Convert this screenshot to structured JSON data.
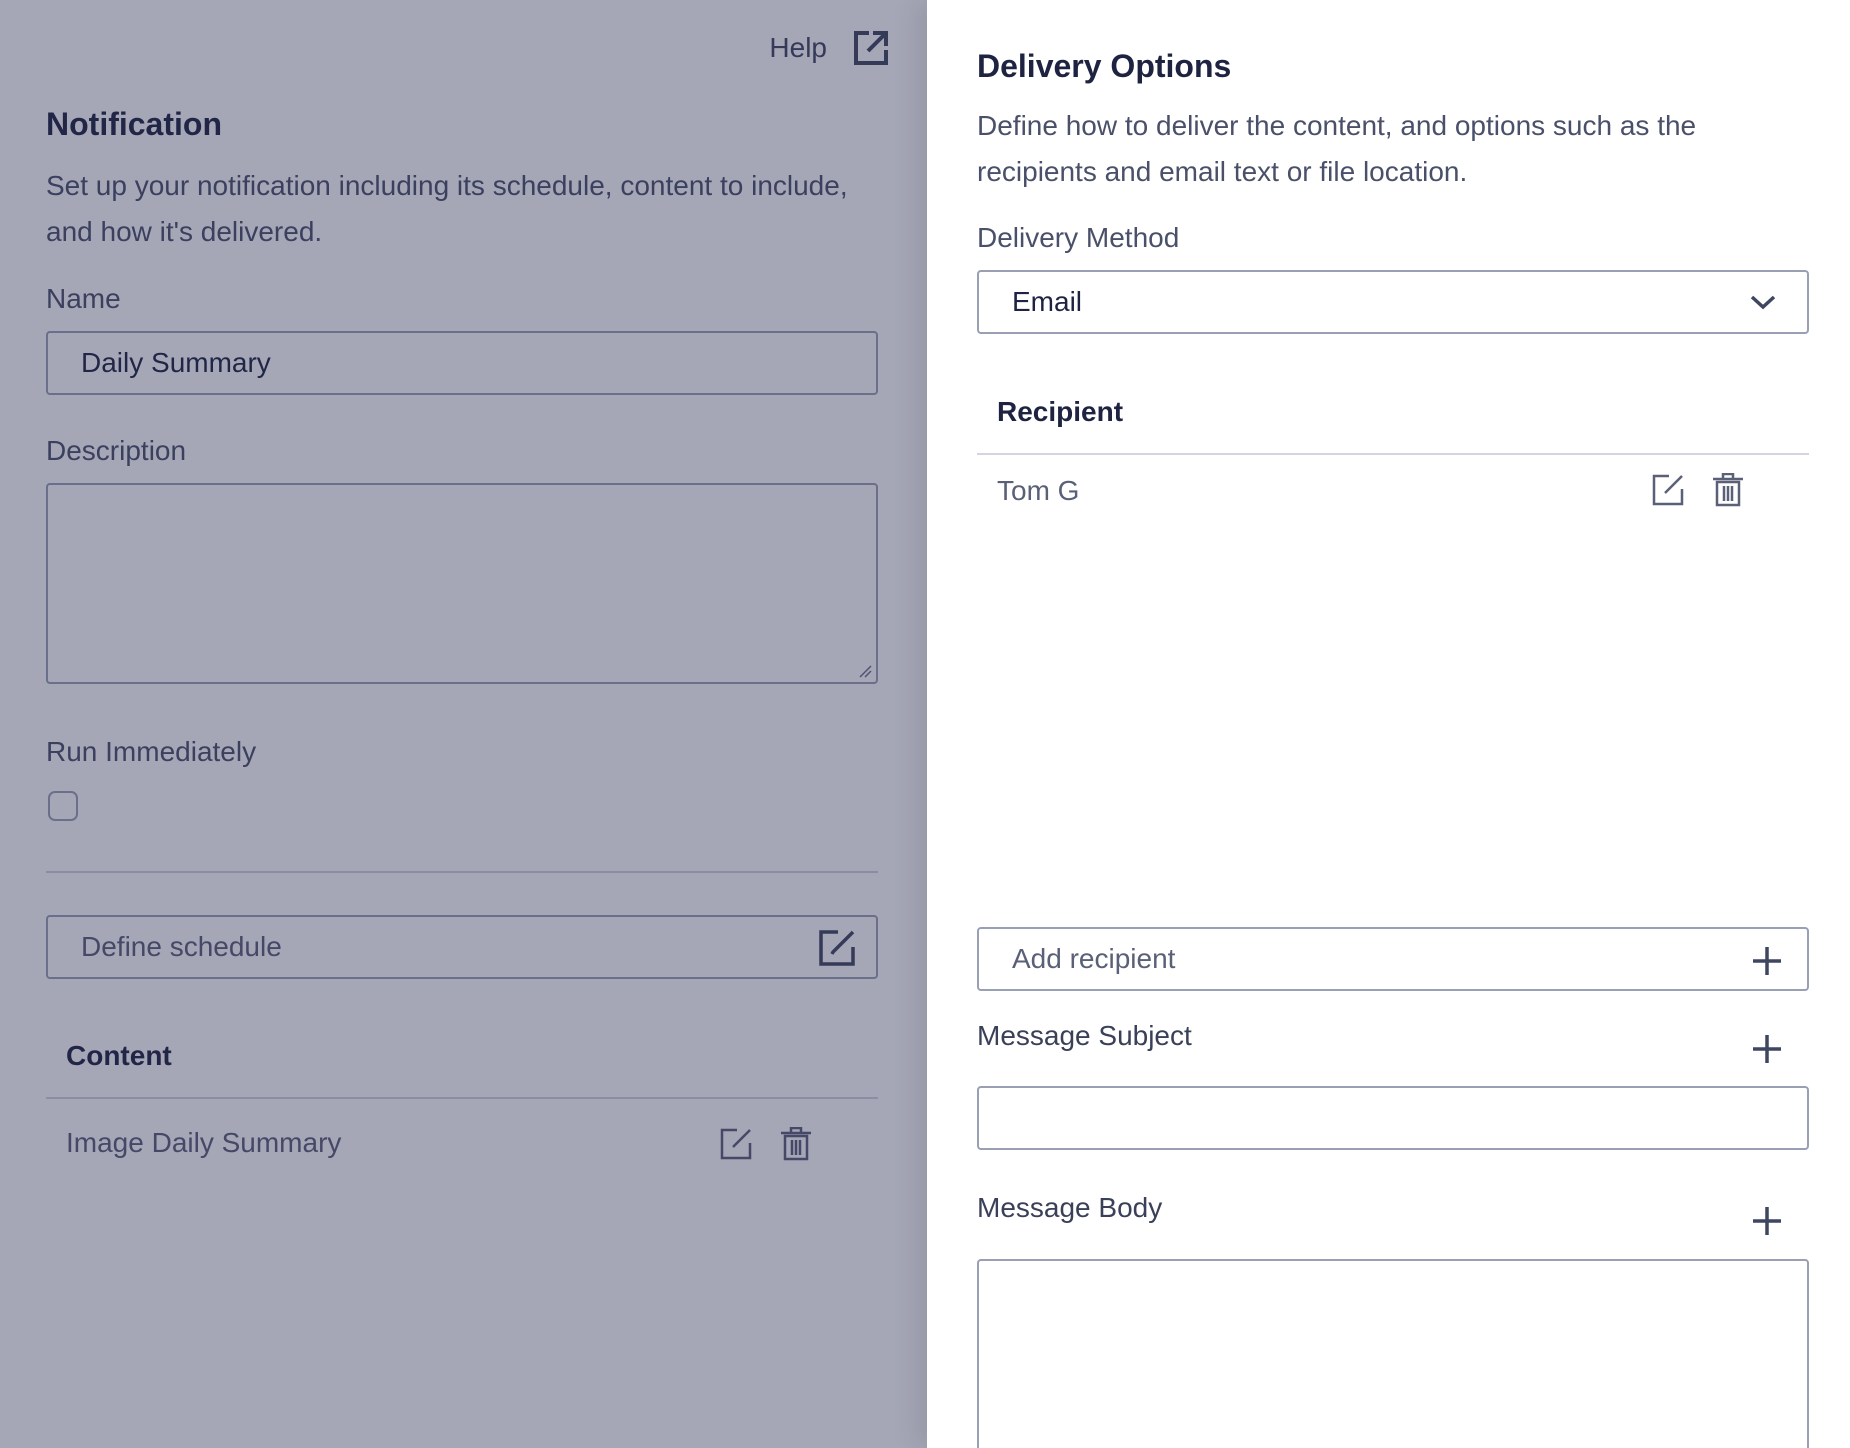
{
  "notification": {
    "help_label": "Help",
    "title": "Notification",
    "description": "Set up your notification including its schedule, content to include, and how it's delivered.",
    "name_label": "Name",
    "name_value": "Daily Summary",
    "description_label": "Description",
    "description_value": "",
    "run_immediately_label": "Run Immediately",
    "run_immediately_checked": false,
    "schedule_placeholder": "Define schedule",
    "content_header": "Content",
    "content_items": [
      {
        "label": "Image Daily Summary"
      }
    ]
  },
  "delivery": {
    "title": "Delivery Options",
    "description": "Define how to deliver the content, and options such as the recipients and email text or file location.",
    "method_label": "Delivery Method",
    "method_value": "Email",
    "recipient_header": "Recipient",
    "recipients": [
      {
        "label": "Tom G"
      }
    ],
    "add_recipient_placeholder": "Add recipient",
    "subject_label": "Message Subject",
    "subject_value": "",
    "body_label": "Message Body",
    "body_value": ""
  },
  "icons": {
    "help": "external-link-icon",
    "schedule_edit": "edit-icon",
    "row_edit": "edit-icon",
    "row_delete": "trash-icon",
    "dropdown": "chevron-down-icon",
    "add": "plus-icon"
  },
  "colors": {
    "heading": "#1d2340",
    "text": "#4a5069",
    "border": "#9aa0b4",
    "overlay": "#282b51"
  }
}
